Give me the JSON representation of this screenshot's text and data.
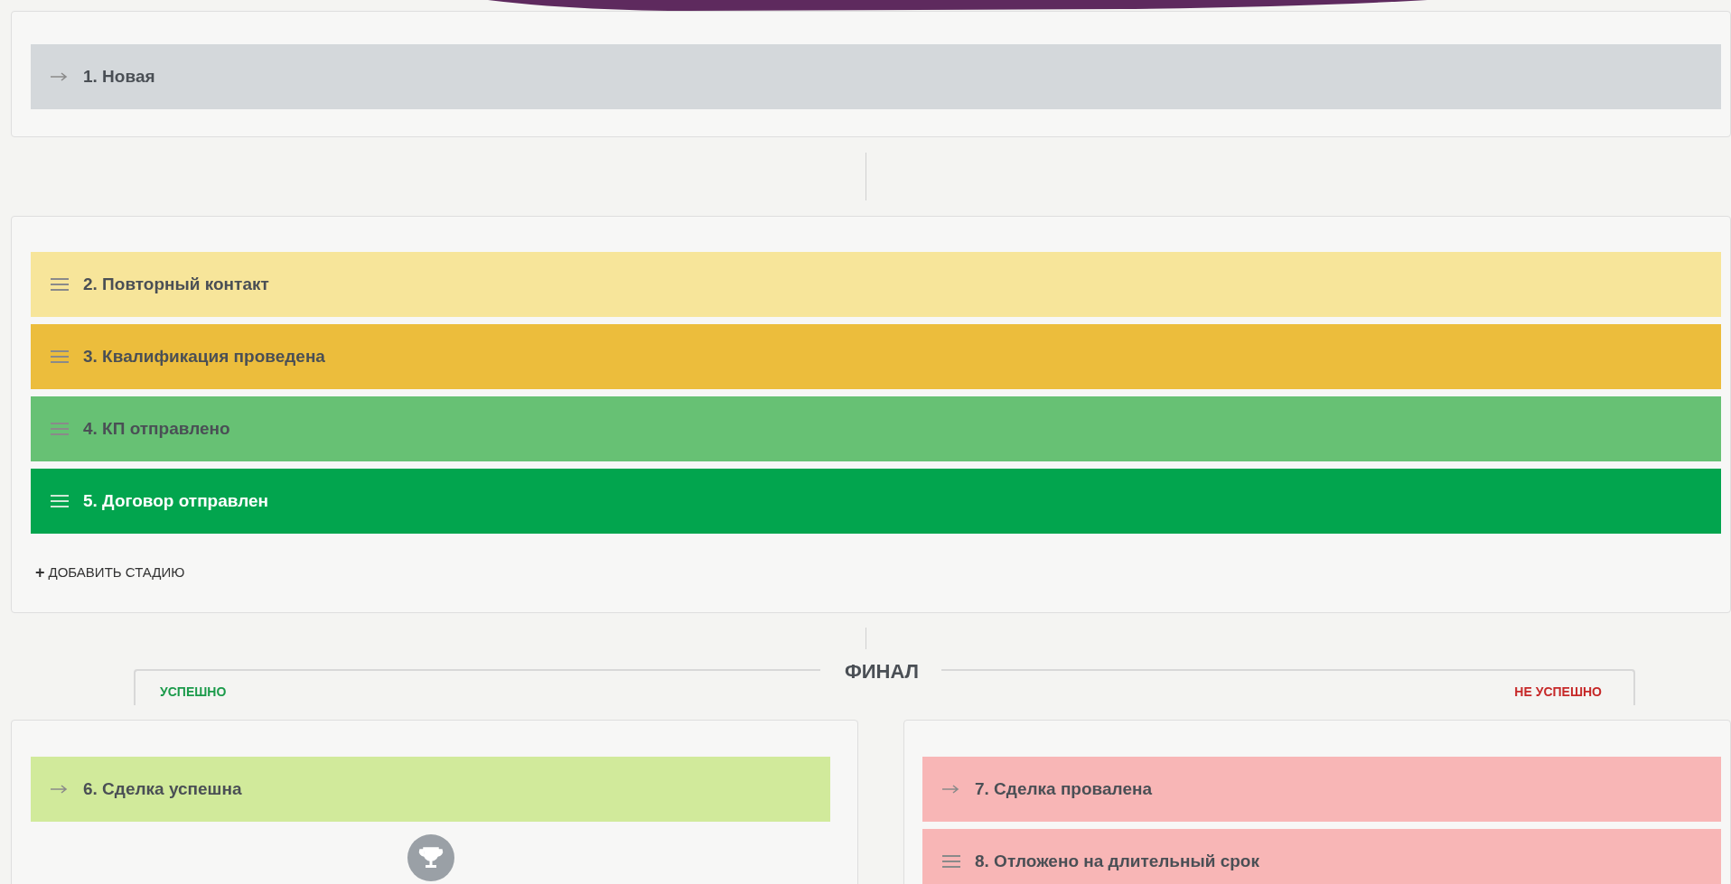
{
  "start_stage": {
    "kind": "fixed",
    "label": "1. Новая",
    "color": "#d4d8db"
  },
  "work_stages": [
    {
      "kind": "draggable",
      "label": "2. Повторный контакт",
      "color": "#f7e59a"
    },
    {
      "kind": "draggable",
      "label": "3. Квалификация проведена",
      "color": "#ecbd3c"
    },
    {
      "kind": "draggable",
      "label": "4. КП отправлено",
      "color": "#67c174"
    },
    {
      "kind": "draggable",
      "label": "5. Договор отправлен",
      "color": "#02a54e"
    }
  ],
  "add_stage": {
    "icon": "+",
    "label": "ДОБАВИТЬ СТАДИЮ"
  },
  "final": {
    "title": "ФИНАЛ",
    "success_label": "УСПЕШНО",
    "failure_label": "НЕ УСПЕШНО",
    "success_stages": [
      {
        "kind": "fixed",
        "label": "6. Сделка успешна",
        "color": "#d1ea9b"
      }
    ],
    "failure_stages": [
      {
        "kind": "fixed",
        "label": "7. Сделка провалена",
        "color": "#f8b6b6"
      },
      {
        "kind": "draggable",
        "label": "8. Отложено на длительный срок",
        "color": "#f8b6b6"
      }
    ]
  }
}
